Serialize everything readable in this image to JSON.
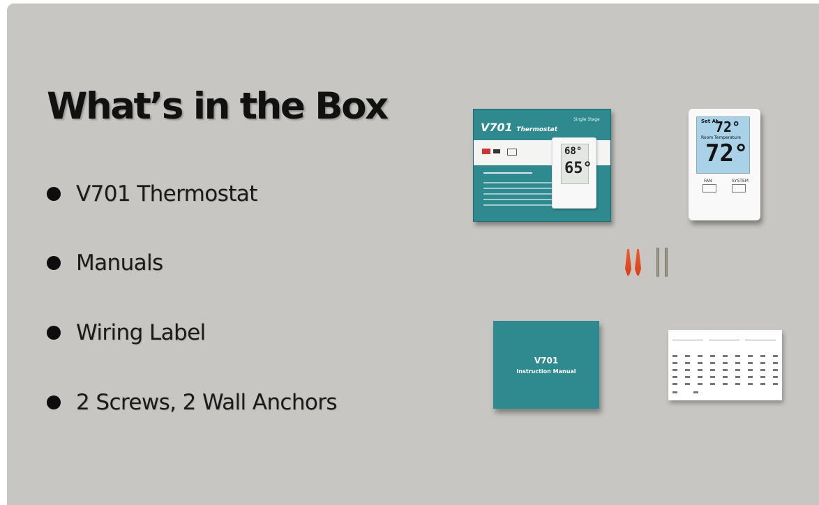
{
  "slide": {
    "title": "What’s in the Box",
    "items": [
      {
        "label": "V701 Thermostat"
      },
      {
        "label": "Manuals"
      },
      {
        "label": "Wiring Label"
      },
      {
        "label": "2 Screws, 2 Wall Anchors"
      }
    ]
  },
  "box": {
    "title": "V701",
    "subtitle": "Thermostat",
    "tagline": "Single Stage",
    "screen_set": "68°",
    "screen_room": "65°"
  },
  "unit": {
    "set_label": "Set At",
    "set_value": "72°",
    "room_label": "Room Temperature",
    "room_value": "72°",
    "fan_label": "FAN",
    "system_label": "SYSTEM"
  },
  "manual": {
    "title": "V701",
    "subtitle": "Instruction Manual"
  },
  "colors": {
    "background": "#c7c6c2",
    "teal": "#2f8a8f",
    "anchor": "#e5502a"
  }
}
